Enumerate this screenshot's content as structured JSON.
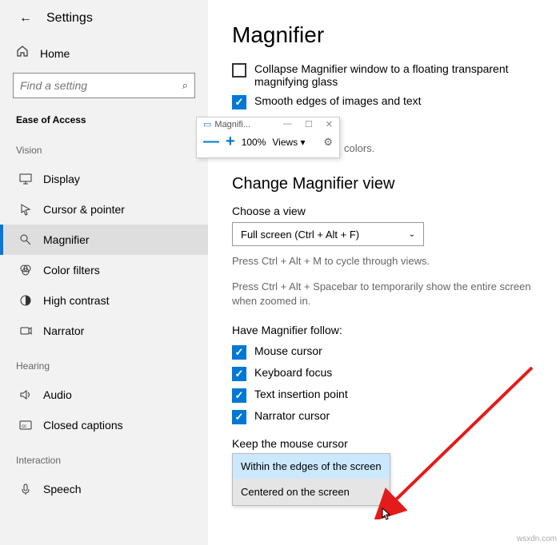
{
  "header": {
    "back_icon": "←",
    "settings_label": "Settings"
  },
  "home": {
    "label": "Home"
  },
  "search": {
    "placeholder": "Find a setting",
    "icon": "⌕"
  },
  "section_main": "Ease of Access",
  "sections": {
    "vision": {
      "title": "Vision",
      "items": [
        {
          "label": "Display"
        },
        {
          "label": "Cursor & pointer"
        },
        {
          "label": "Magnifier"
        },
        {
          "label": "Color filters"
        },
        {
          "label": "High contrast"
        },
        {
          "label": "Narrator"
        }
      ]
    },
    "hearing": {
      "title": "Hearing",
      "items": [
        {
          "label": "Audio"
        },
        {
          "label": "Closed captions"
        }
      ]
    },
    "interaction": {
      "title": "Interaction",
      "items": [
        {
          "label": "Speech"
        }
      ]
    }
  },
  "main": {
    "title": "Magnifier",
    "opt_collapse": "Collapse Magnifier window to a floating transparent magnifying glass",
    "opt_smooth": "Smooth edges of images and text",
    "colors_fragment": "colors.",
    "change_view_heading": "Change Magnifier view",
    "choose_view_label": "Choose a view",
    "view_selected": "Full screen (Ctrl + Alt + F)",
    "hint_cycle": "Press Ctrl + Alt + M to cycle through views.",
    "hint_spacebar": "Press Ctrl + Alt + Spacebar to temporarily show the entire screen when zoomed in.",
    "follow_label": "Have Magnifier follow:",
    "follow": [
      "Mouse cursor",
      "Keyboard focus",
      "Text insertion point",
      "Narrator cursor"
    ],
    "keep_label": "Keep the mouse cursor",
    "keep_options": [
      "Within the edges of the screen",
      "Centered on the screen"
    ]
  },
  "mag_toolbar": {
    "title": "Magnifi...",
    "minimize": "—",
    "maximize": "☐",
    "close": "✕",
    "minus": "—",
    "plus": "+",
    "zoom": "100%",
    "views": "Views ▾",
    "gear": "⚙"
  },
  "watermark": "wsxdn.com"
}
